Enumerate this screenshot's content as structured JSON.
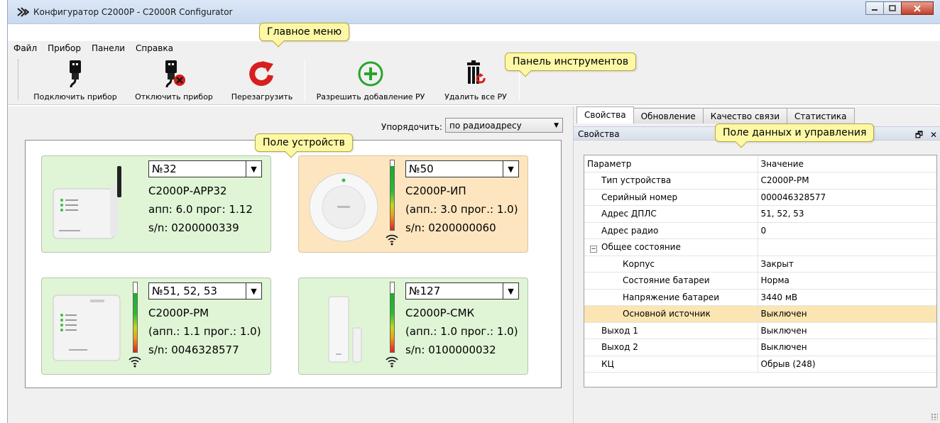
{
  "window": {
    "title": "Конфигуратор С2000Р - C2000R Configurator",
    "controls": [
      "minimize",
      "maximize",
      "close"
    ]
  },
  "menu": [
    "Файл",
    "Прибор",
    "Панели",
    "Справка"
  ],
  "toolbar": {
    "connect": "Подключить прибор",
    "disconnect": "Отключить прибор",
    "reboot": "Перезагрузить",
    "allow_add": "Разрешить добавление РУ",
    "delete_all": "Удалить все РУ"
  },
  "sort": {
    "label": "Упорядочить:",
    "value": "по радиоадресу"
  },
  "devices": [
    {
      "address": "№32",
      "name": "С2000Р-АРР32",
      "version": "апп: 6.0 прог: 1.12",
      "serial": "s/n: 0200000339",
      "state": "ok",
      "signal": null
    },
    {
      "address": "№50",
      "name": "С2000Р-ИП",
      "version": "(апп.: 3.0 прог.: 1.0)",
      "serial": "s/n: 0200000060",
      "state": "warning",
      "signal": 0.92
    },
    {
      "address": "№51, 52, 53",
      "name": "С2000Р-РМ",
      "version": "(апп.: 1.1 прог.: 1.0)",
      "serial": "s/n: 0046328577",
      "state": "ok",
      "signal": 0.85
    },
    {
      "address": "№127",
      "name": "С2000Р-СМК",
      "version": "(апп.: 1.0 прог.: 1.0)",
      "serial": "s/n: 0100000032",
      "state": "ok",
      "signal": 0.85
    }
  ],
  "tabs": [
    "Свойства",
    "Обновление",
    "Качество связи",
    "Статистика"
  ],
  "panel_title": "Свойства",
  "properties": {
    "headers": [
      "Параметр",
      "Значение"
    ],
    "rows": [
      {
        "name": "Тип устройства",
        "value": "С2000Р-РМ",
        "level": 1
      },
      {
        "name": "Серийный номер",
        "value": "000046328577",
        "level": 1
      },
      {
        "name": "Адрес ДПЛС",
        "value": "51, 52, 53",
        "level": 1
      },
      {
        "name": "Адрес радио",
        "value": "0",
        "level": 1
      },
      {
        "name": "Общее состояние",
        "value": "",
        "level": 0,
        "group": true
      },
      {
        "name": "Корпус",
        "value": "Закрыт",
        "level": 2
      },
      {
        "name": "Состояние батареи",
        "value": "Норма",
        "level": 2
      },
      {
        "name": "Напряжение батареи",
        "value": "3440 мВ",
        "level": 2
      },
      {
        "name": "Основной источник",
        "value": "Выключен",
        "level": 2,
        "highlight": true
      },
      {
        "name": "Выход 1",
        "value": "Выключен",
        "level": 1
      },
      {
        "name": "Выход 2",
        "value": "Выключен",
        "level": 1
      },
      {
        "name": "КЦ",
        "value": "Обрыв (248)",
        "level": 1
      }
    ]
  },
  "callouts": {
    "main_menu": "Главное меню",
    "toolbar": "Панель инструментов",
    "device_field": "Поле устройств",
    "data_panel": "Поле данных и управления"
  },
  "colors": {
    "card_ok": "#dff5d6",
    "card_warning": "#fde6bf",
    "highlight_row": "#fbe5b2",
    "callout_bg": "#fdf8a6"
  }
}
